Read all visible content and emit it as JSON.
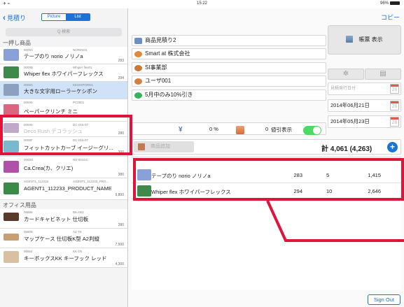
{
  "status": {
    "left": "✈ ≈",
    "time": "15:22",
    "battery": "96%"
  },
  "left": {
    "back_label": "見積り",
    "seg": [
      "Picture",
      "List"
    ],
    "search_placeholder": "Q 検索",
    "categories": {
      "cat1": "一押し商品",
      "cat2": "オフィス用品"
    },
    "items": [
      {
        "code": "0000A",
        "maker": "NORINO1",
        "name": "テープのり norio ノリノa",
        "price": "283",
        "color": "#8aa0d8"
      },
      {
        "code": "0000B",
        "maker": "Whiper flex01",
        "name": "Whiper flex ホワイパーフレックス",
        "price": "294",
        "color": "#3f8a4a"
      },
      {
        "code": "0000C",
        "maker": "KESHIPORN1",
        "name": "大きな文字用ローラーケシポン",
        "price": "",
        "color": "#8ea0c0"
      },
      {
        "code": "00000",
        "maker": "PC0001",
        "name": "ペーパークリンチ ミニ",
        "price": "493",
        "color": "#d9677f"
      },
      {
        "code": "00000",
        "maker": "DC-016-07",
        "name": "Deco Rush デコラッシュ",
        "price": "280",
        "color": "#c0a8c8"
      },
      {
        "code": "0000F",
        "maker": "DC-016-07",
        "name": "フィットカットカーブ イージーグリ...",
        "price": "300",
        "color": "#7ab8d0"
      },
      {
        "code": "0000G",
        "maker": "NS-001GC",
        "name": "Ca.Crea(カ、クリエ)",
        "price": "380",
        "color": "#b050a8"
      },
      {
        "code": "AGENT1_112233",
        "maker": "AGENT1_112233_PRO...",
        "name": "AGENT1_112233_PRODUCT_NAME",
        "price": "9,800",
        "color": "#3a8a48"
      },
      {
        "code": "06885",
        "maker": "B6-AB3",
        "name": "カードキャビネット 仕切板",
        "price": "280",
        "color": "#5a3a2a"
      },
      {
        "code": "06805",
        "maker": "A2-TK",
        "name": "マップケース 仕切板K型 A2判縦",
        "price": "7,500",
        "color": "#c8a070"
      },
      {
        "code": "06954",
        "maker": "KK-1N",
        "name": "キーボックスKK キーフック レッド",
        "price": "4,300",
        "color": "#d8c0a0"
      }
    ]
  },
  "right": {
    "copy_label": "コピー",
    "fields": {
      "title": "商品見積り2",
      "company": "Smart at 株式会社",
      "department": "SI事業部",
      "user": "ユーザ001",
      "campaign": "5月中のみ10%引き"
    },
    "report_button": "帳票 表示",
    "issue_date_placeholder": "見積発行日付",
    "cal_day": "26",
    "date1": "2014年06月21日",
    "date2": "2014年05月23日",
    "discount": {
      "yen_value": "0 %",
      "pct_value": "0",
      "label": "値引表示"
    },
    "add_label": "商品追加",
    "total": "計 4,061 (4,263)",
    "lines": [
      {
        "name": "テープのり norio ノリノa",
        "price": "283",
        "qty": "5",
        "amount": "1,415",
        "color": "#8aa0d8"
      },
      {
        "name": "Whiper flex ホワイパーフレックス",
        "price": "294",
        "qty": "10",
        "amount": "2,646",
        "color": "#3f8a4a"
      }
    ],
    "signout": "Sign Out"
  },
  "colors": {
    "accent": "#1a74d8",
    "highlight": "#e0133a",
    "toggle_on": "#4cd964"
  }
}
